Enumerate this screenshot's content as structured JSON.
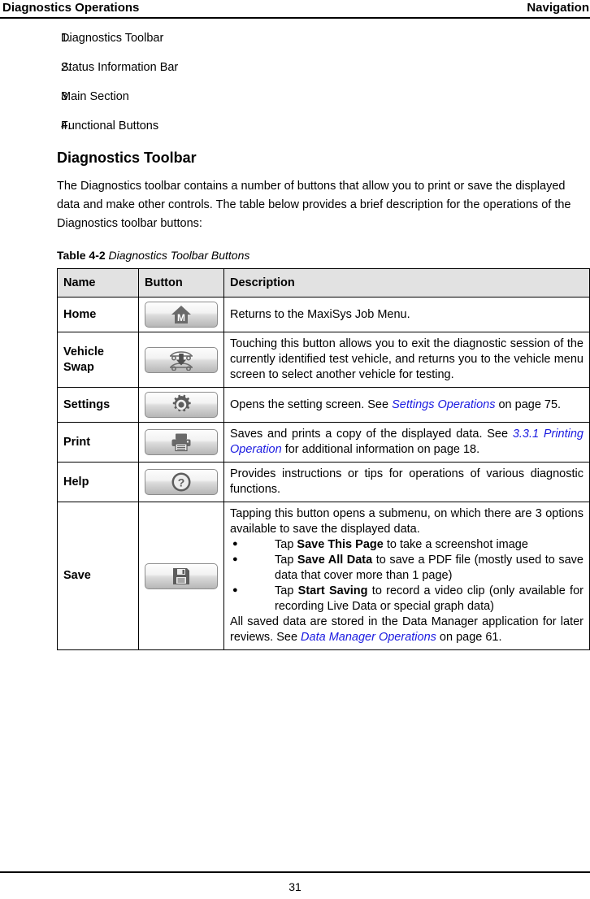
{
  "header": {
    "left_title": "Diagnostics Operations",
    "right_title": "Navigation"
  },
  "numbered_list": [
    {
      "num": "1.",
      "label": "Diagnostics Toolbar"
    },
    {
      "num": "2.",
      "label": "Status Information Bar"
    },
    {
      "num": "3.",
      "label": "Main Section"
    },
    {
      "num": "4.",
      "label": "Functional Buttons"
    }
  ],
  "section": {
    "title": "Diagnostics Toolbar",
    "intro": "The Diagnostics toolbar contains a number of buttons that allow you to print or save the displayed data and make other controls. The table below provides a brief description for the operations of the Diagnostics toolbar buttons:"
  },
  "table_caption": {
    "label": "Table 4-2",
    "title": "Diagnostics Toolbar Buttons"
  },
  "table": {
    "columns": [
      "Name",
      "Button",
      "Description"
    ],
    "rows": [
      {
        "name": "Home",
        "icon": "home-m-icon",
        "description": "Returns to the MaxiSys Job Menu."
      },
      {
        "name": "Vehicle Swap",
        "icon": "vehicle-swap-icon",
        "description": "Touching this button allows you to exit the diagnostic session of the currently identified test vehicle, and returns you to the vehicle menu screen to select another vehicle for testing."
      },
      {
        "name": "Settings",
        "icon": "gear-icon",
        "desc_prefix": "Opens the setting screen. See ",
        "desc_link": "Settings Operations",
        "desc_suffix": " on page 75."
      },
      {
        "name": "Print",
        "icon": "printer-icon",
        "desc_prefix": "Saves and prints a copy of the displayed data. See ",
        "desc_link": "3.3.1 Printing Operation",
        "desc_suffix": " for additional information on page 18."
      },
      {
        "name": "Help",
        "icon": "question-circle-icon",
        "description": "Provides instructions or tips for operations of various diagnostic functions."
      },
      {
        "name": "Save",
        "icon": "floppy-disk-icon",
        "intro": "Tapping this button opens a submenu, on which there are 3 options available to save the displayed data.",
        "bullets": [
          {
            "pre": "Tap ",
            "bold": "Save This Page",
            "post": " to take a screenshot image"
          },
          {
            "pre": "Tap ",
            "bold": "Save All Data",
            "post": " to save a PDF file (mostly used to save data that cover more than 1 page)"
          },
          {
            "pre": "Tap ",
            "bold": "Start Saving",
            "post": " to record a video clip (only available for recording Live Data or special graph data)"
          }
        ],
        "outro_prefix": "All saved data are stored in the Data Manager application for later reviews. See ",
        "outro_link": "Data Manager Operations",
        "outro_suffix": " on page 61."
      }
    ]
  },
  "footer": {
    "page_number": "31"
  }
}
